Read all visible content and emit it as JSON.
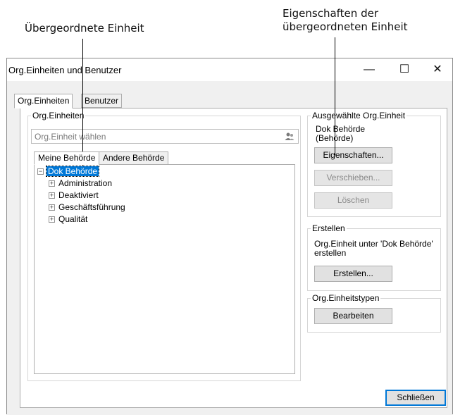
{
  "annotations": {
    "left": "Übergeordnete Einheit",
    "right_line1": "Eigenschaften der",
    "right_line2": "übergeordneten Einheit"
  },
  "window": {
    "title": "Org.Einheiten und Benutzer",
    "minimize": "—",
    "maximize": "☐",
    "close": "✕"
  },
  "tabs": [
    {
      "label": "Org.Einheiten",
      "active": true
    },
    {
      "label": "Benutzer",
      "active": false
    }
  ],
  "org_group": {
    "title": "Org.Einheiten",
    "search_placeholder": "Org.Einheit wählen",
    "subtabs": [
      {
        "label": "Meine Behörde",
        "active": true
      },
      {
        "label": "Andere Behörde",
        "active": false
      }
    ],
    "tree": {
      "root": "Dok Behörde",
      "children": [
        "Administration",
        "Deaktiviert",
        "Geschäftsführung",
        "Qualität"
      ]
    }
  },
  "selected_group": {
    "title": "Ausgewählte Org.Einheit",
    "name": "Dok Behörde",
    "type": "(Behörde)",
    "properties_button": "Eigenschaften...",
    "move_button": "Verschieben...",
    "delete_button": "Löschen"
  },
  "create_group": {
    "title": "Erstellen",
    "text_line1": "Org.Einheit unter 'Dok Behörde'",
    "text_line2": "erstellen",
    "create_button": "Erstellen..."
  },
  "types_group": {
    "title": "Org.Einheitstypen",
    "edit_button": "Bearbeiten"
  },
  "footer": {
    "close_button": "Schließen"
  },
  "colors": {
    "accent": "#0078d7",
    "client_bg": "#f0f0f0"
  }
}
